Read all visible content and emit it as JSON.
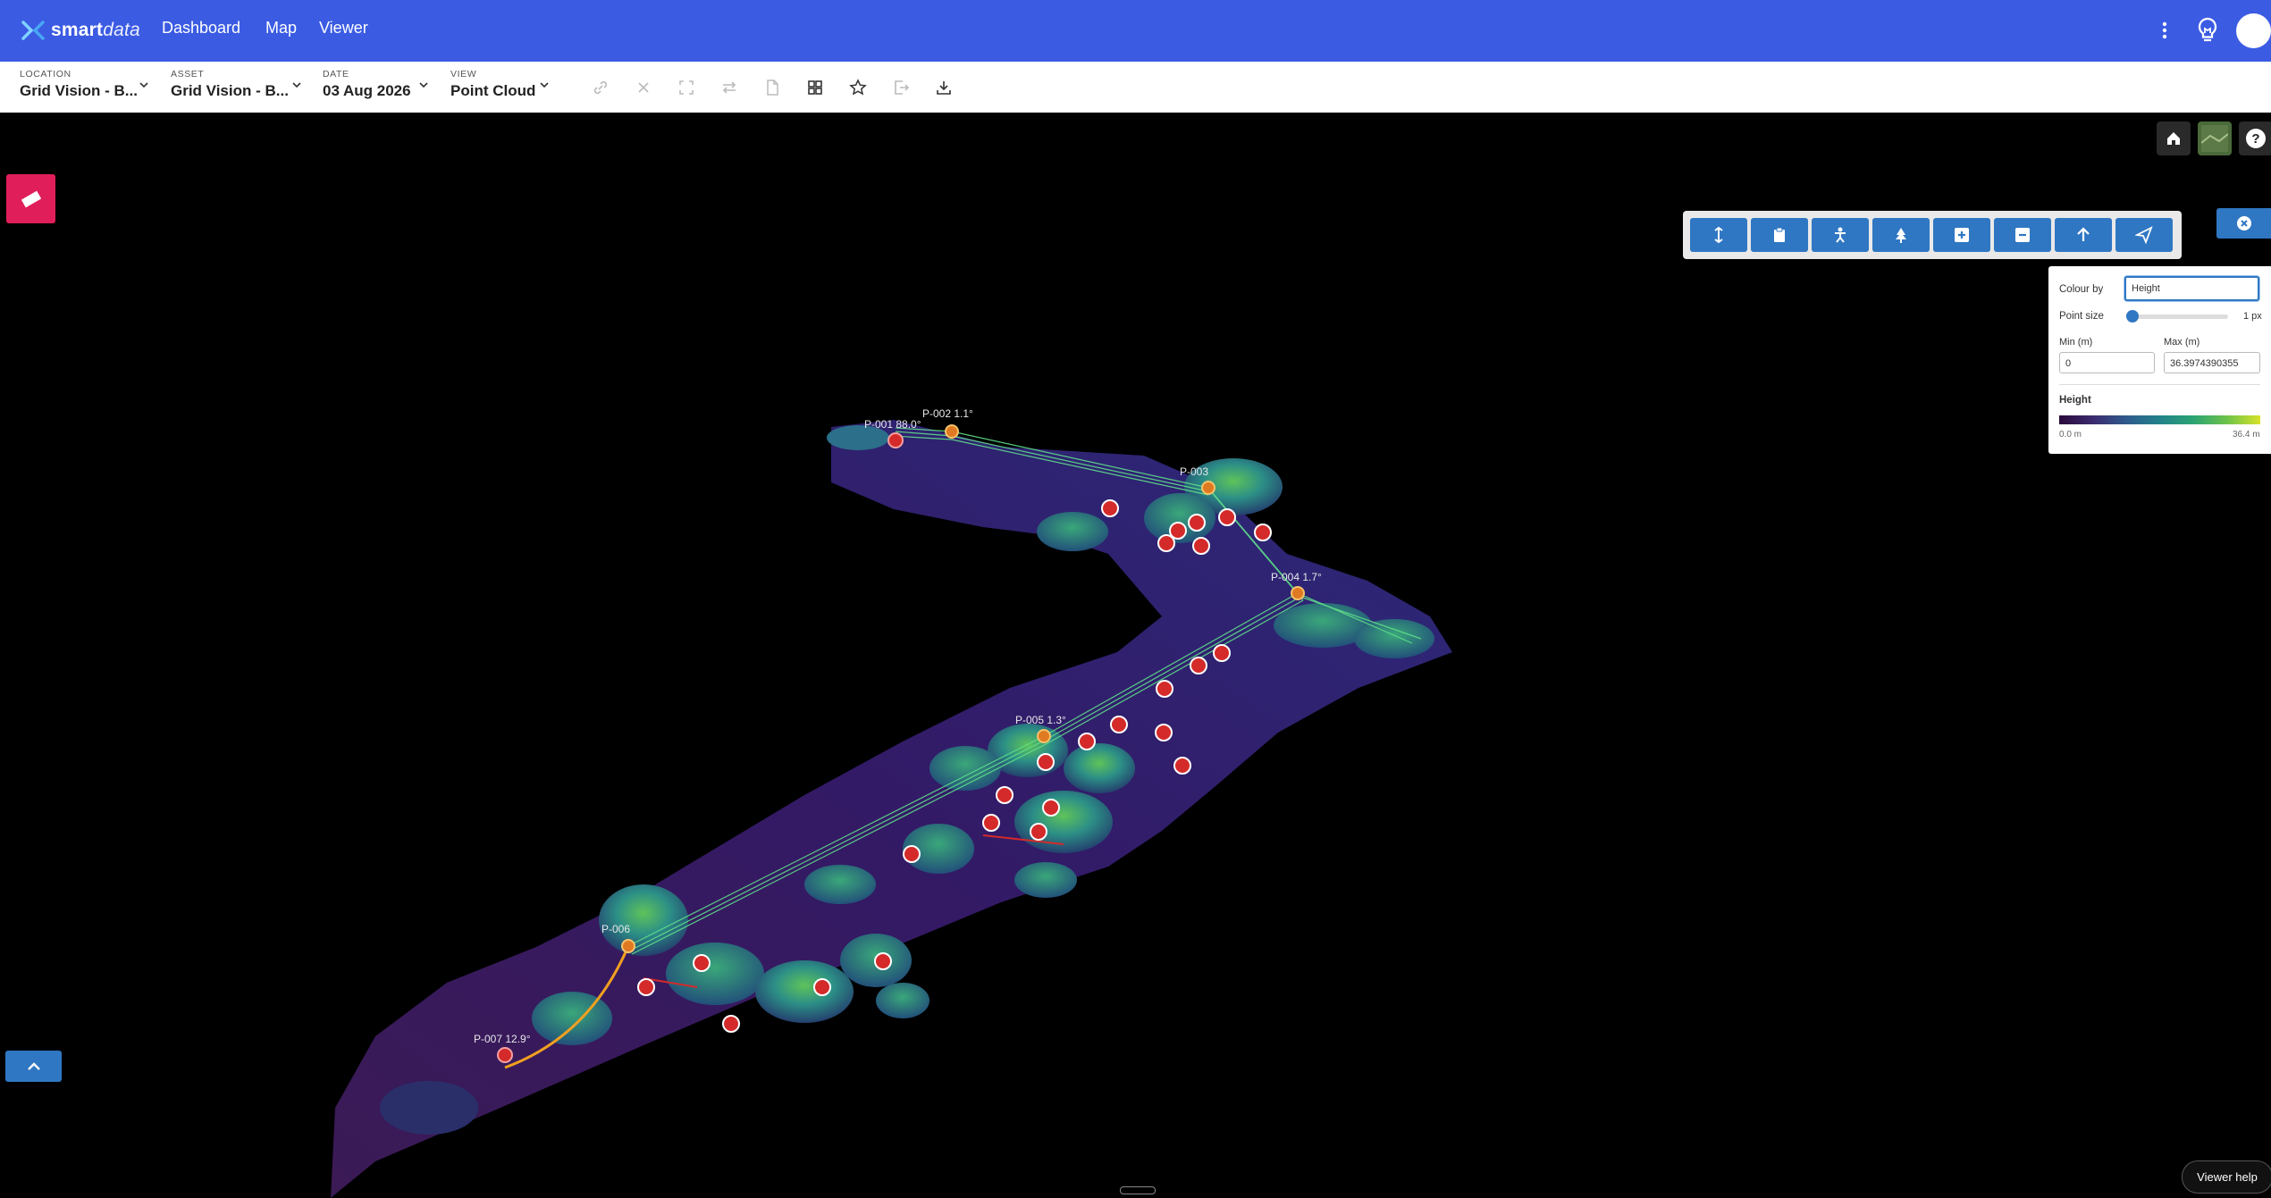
{
  "app": {
    "brand_bold": "smart",
    "brand_light": "data",
    "nav": [
      "Dashboard",
      "Map",
      "Viewer"
    ]
  },
  "context": {
    "location": {
      "label": "LOCATION",
      "value": "Grid Vision - B..."
    },
    "asset": {
      "label": "ASSET",
      "value": "Grid Vision - B..."
    },
    "date": {
      "label": "DATE",
      "value": "03 Aug 2026"
    },
    "view": {
      "label": "VIEW",
      "value": "Point Cloud"
    }
  },
  "toolbar_icons": [
    "link-icon",
    "close-x-icon",
    "fullscreen-icon",
    "swap-icon",
    "document-icon",
    "grid-icon",
    "star-icon",
    "export-icon",
    "download-icon"
  ],
  "tools": [
    "height-measure-icon",
    "clipboard-icon",
    "person-icon",
    "tree-icon",
    "plus-square-icon",
    "minus-square-icon",
    "arrow-up-icon",
    "send-icon"
  ],
  "settings": {
    "colour_by_label": "Colour by",
    "colour_by_value": "Height",
    "point_size_label": "Point size",
    "point_size_value": "1 px",
    "min_label": "Min (m)",
    "min_value": "0",
    "max_label": "Max (m)",
    "max_value": "36.3974390355",
    "legend_title": "Height",
    "legend_min": "0.0 m",
    "legend_max": "36.4 m"
  },
  "poles": [
    {
      "id": "P-001 88.0°"
    },
    {
      "id": "P-002 1.1°"
    },
    {
      "id": "P-003"
    },
    {
      "id": "P-004 1.7°"
    },
    {
      "id": "P-005 1.3°"
    },
    {
      "id": "P-006"
    },
    {
      "id": "P-007 12.9°"
    }
  ],
  "viewer_help": "Viewer help",
  "colors": {
    "nav": "#3b5be3",
    "tool": "#2f77c3",
    "measure": "#e01e5a",
    "marker": "#d42a2a",
    "pole": "#e07a22"
  }
}
